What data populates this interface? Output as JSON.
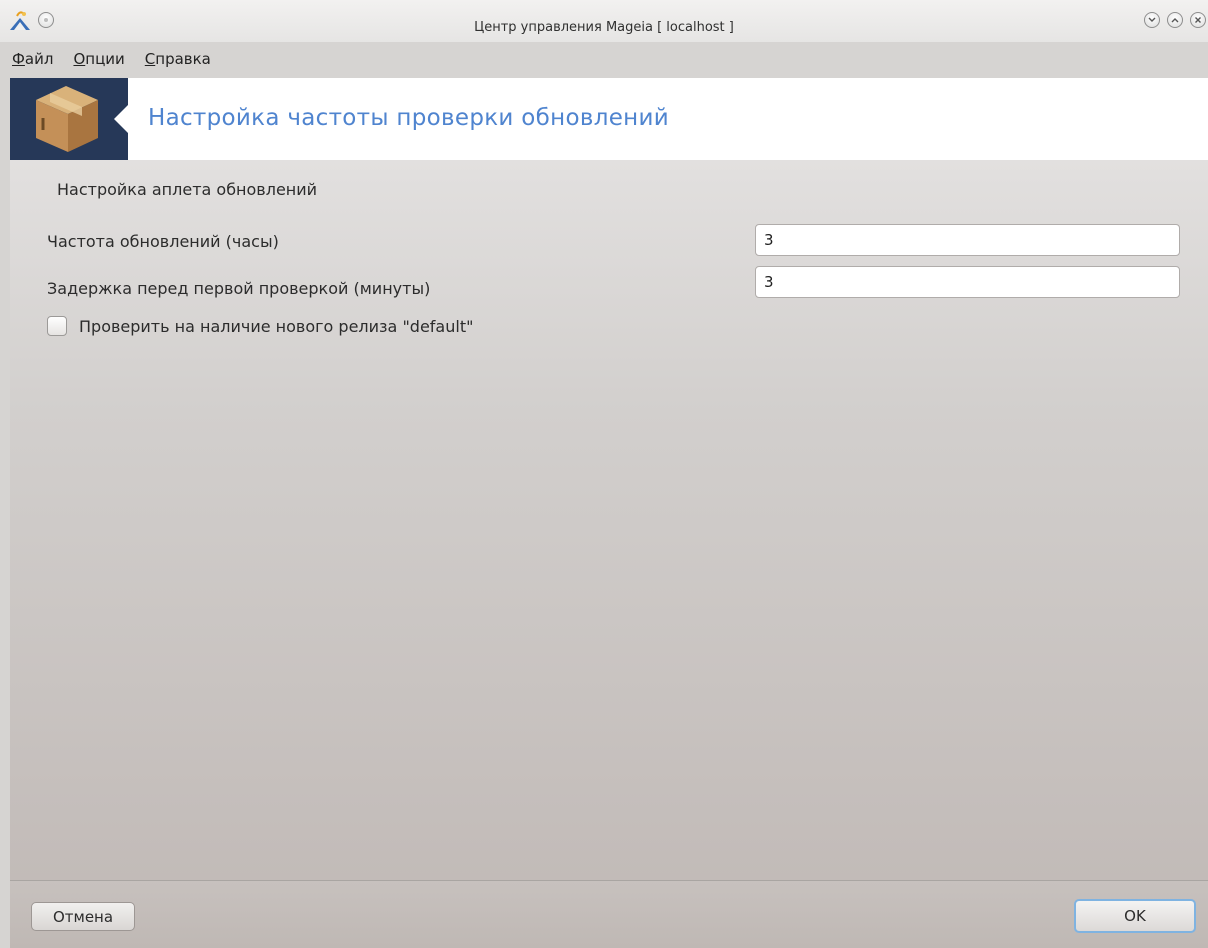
{
  "window": {
    "title": "Центр управления Mageia  [ localhost ]"
  },
  "menu": {
    "items": [
      {
        "mnemonic": "Ф",
        "rest": "айл"
      },
      {
        "mnemonic": "О",
        "rest": "пции"
      },
      {
        "mnemonic": "С",
        "rest": "правка"
      }
    ]
  },
  "banner": {
    "title": "Настройка частоты проверки обновлений",
    "icon": "package-box-icon"
  },
  "form": {
    "section_title": "Настройка аплета обновлений",
    "update_frequency_label": "Частота обновлений (часы)",
    "update_frequency_value": "3",
    "initial_delay_label": "Задержка перед первой проверкой (минуты)",
    "initial_delay_value": "3",
    "check_release_label": "Проверить на наличие нового релиза \"default\"",
    "check_release_checked": false
  },
  "footer": {
    "cancel_label": "Отмена",
    "ok_label": "OK"
  },
  "colors": {
    "banner_title": "#4f84cf",
    "logo_background": "#263858",
    "ok_focus_border": "#7fb3e1"
  }
}
